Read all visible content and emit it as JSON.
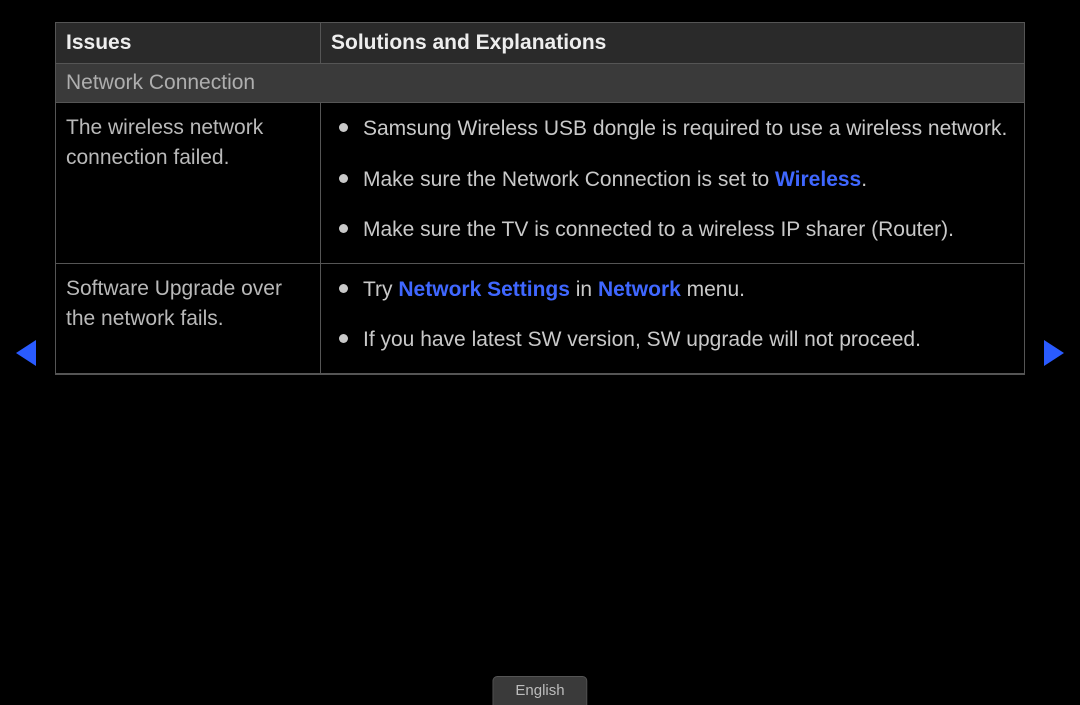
{
  "headers": {
    "issues": "Issues",
    "solutions": "Solutions and Explanations"
  },
  "category": "Network Connection",
  "rows": [
    {
      "issue": "The wireless network connection failed.",
      "solutions": [
        {
          "prefix": "Samsung Wireless USB dongle is required to use a wireless network."
        },
        {
          "prefix": "Make sure the Network Connection is set to ",
          "hl": "Wireless",
          "suffix": "."
        },
        {
          "prefix": "Make sure the TV is connected to a wireless IP sharer (Router)."
        }
      ]
    },
    {
      "issue": "Software Upgrade over the network fails.",
      "solutions": [
        {
          "prefix": "Try ",
          "hl": "Network Settings",
          "mid": " in ",
          "hl2": "Network",
          "suffix": " menu."
        },
        {
          "prefix": "If you have latest SW version, SW upgrade will not proceed."
        }
      ]
    }
  ],
  "language": "English"
}
